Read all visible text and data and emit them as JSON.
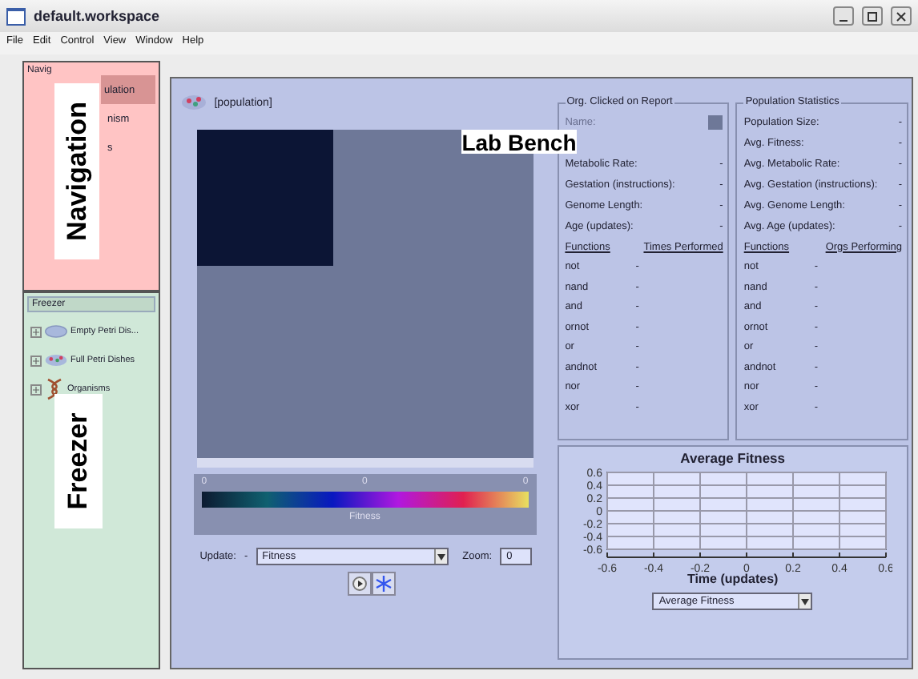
{
  "window": {
    "title": "default.workspace"
  },
  "menu": [
    "File",
    "Edit",
    "Control",
    "View",
    "Window",
    "Help"
  ],
  "navigation": {
    "header": "Navig",
    "items": [
      {
        "label": "ulation",
        "selected": true
      },
      {
        "label": "nism",
        "selected": false
      },
      {
        "label": "s",
        "selected": false
      }
    ]
  },
  "freezer": {
    "header": "Freezer",
    "items": [
      {
        "label": "Empty Petri Dis...",
        "kind": "dish"
      },
      {
        "label": "Full Petri Dishes",
        "kind": "full"
      },
      {
        "label": "Organisms",
        "kind": "organism"
      }
    ]
  },
  "overlays": [
    {
      "label": "Navigation",
      "kind": "vertical"
    },
    {
      "label": "Freezer",
      "kind": "vertical"
    },
    {
      "label": "Lab Bench",
      "kind": "horizontal"
    }
  ],
  "population": {
    "title": "[population]",
    "scale_labels": [
      "0",
      "0",
      "0"
    ],
    "scale_title": "Fitness",
    "update_label": "Update:",
    "update_value": "-",
    "mode": "Fitness",
    "zoom_label": "Zoom:",
    "zoom": "0"
  },
  "org_report": {
    "title": "Org. Clicked on  Report",
    "rows": [
      {
        "label": "Name:",
        "value": "",
        "kind": "swatch"
      },
      {
        "label": "",
        "value": "",
        "kind": "hidden"
      },
      {
        "label": "Metabolic Rate:",
        "value": "-",
        "kind": "text"
      },
      {
        "label": "Gestation (instructions):",
        "value": "-",
        "kind": "text"
      },
      {
        "label": "Genome Length:",
        "value": "-",
        "kind": "text"
      },
      {
        "label": "Age (updates):",
        "value": "-",
        "kind": "text"
      }
    ],
    "columns": [
      "Functions",
      "Times Performed"
    ],
    "functions": [
      {
        "name": "not",
        "value": "-"
      },
      {
        "name": "nand",
        "value": "-"
      },
      {
        "name": "and",
        "value": "-"
      },
      {
        "name": "ornot",
        "value": "-"
      },
      {
        "name": "or",
        "value": "-"
      },
      {
        "name": "andnot",
        "value": "-"
      },
      {
        "name": "nor",
        "value": "-"
      },
      {
        "name": "xor",
        "value": "-"
      }
    ]
  },
  "population_stats": {
    "title": "Population Statistics",
    "rows": [
      {
        "label": "Population Size:",
        "value": "-",
        "kind": "text"
      },
      {
        "label": "Avg. Fitness:",
        "value": "-",
        "kind": "text"
      },
      {
        "label": "Avg. Metabolic Rate:",
        "value": "-",
        "kind": "text"
      },
      {
        "label": "Avg. Gestation (instructions):",
        "value": "-",
        "kind": "text"
      },
      {
        "label": "Avg. Genome Length:",
        "value": "-",
        "kind": "text"
      },
      {
        "label": "Avg. Age (updates):",
        "value": "-",
        "kind": "text"
      }
    ],
    "columns": [
      "Functions",
      "Orgs Performing"
    ],
    "functions": [
      {
        "name": "not",
        "value": "-"
      },
      {
        "name": "nand",
        "value": "-"
      },
      {
        "name": "and",
        "value": "-"
      },
      {
        "name": "ornot",
        "value": "-"
      },
      {
        "name": "or",
        "value": "-"
      },
      {
        "name": "andnot",
        "value": "-"
      },
      {
        "name": "nor",
        "value": "-"
      },
      {
        "name": "xor",
        "value": "-"
      }
    ]
  },
  "chart": {
    "dropdown": "Average Fitness",
    "chart_data": {
      "type": "line",
      "title": "Average Fitness",
      "xlabel": "Time (updates)",
      "xlim": [
        -0.6,
        0.6
      ],
      "ylim": [
        -0.6,
        0.6
      ],
      "xticks": [
        -0.6,
        -0.4,
        -0.2,
        0,
        0.2,
        0.4,
        0.6
      ],
      "yticks": [
        0.6,
        0.4,
        0.2,
        0,
        -0.2,
        -0.4,
        -0.6
      ],
      "grid": true
    }
  }
}
